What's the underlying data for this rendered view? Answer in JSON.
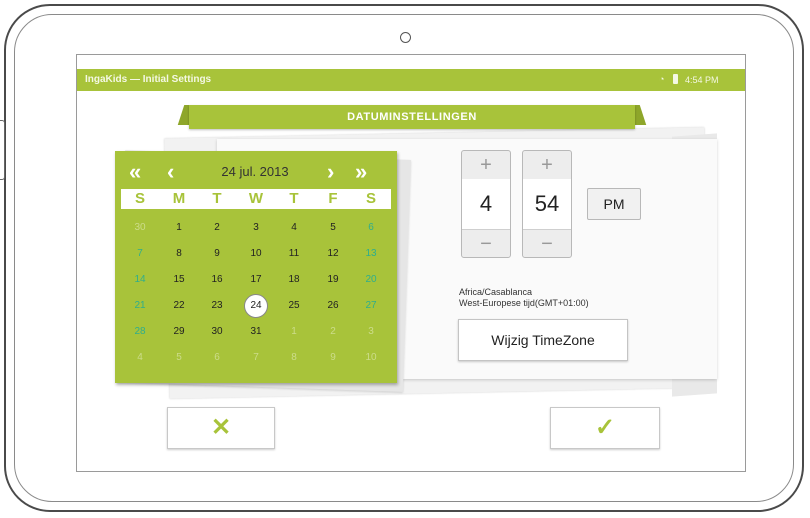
{
  "titlebar": {
    "app_title": "IngaKids — Initial Settings",
    "time": "4:54 PM",
    "wifi_icon": "wifi-icon",
    "battery_icon": "battery-icon"
  },
  "banner": {
    "title": "DATUMINSTELLINGEN"
  },
  "calendar": {
    "nav_prev_year": "«",
    "nav_prev_month": "‹",
    "nav_next_month": "›",
    "nav_next_year": "»",
    "month_label": "24 jul. 2013",
    "weekdays": [
      "S",
      "M",
      "T",
      "W",
      "T",
      "F",
      "S"
    ],
    "weeks": [
      [
        "30",
        "1",
        "2",
        "3",
        "4",
        "5",
        "6"
      ],
      [
        "7",
        "8",
        "9",
        "10",
        "11",
        "12",
        "13"
      ],
      [
        "14",
        "15",
        "16",
        "17",
        "18",
        "19",
        "20"
      ],
      [
        "21",
        "22",
        "23",
        "24",
        "25",
        "26",
        "27"
      ],
      [
        "28",
        "29",
        "30",
        "31",
        "1",
        "2",
        "3"
      ],
      [
        "4",
        "5",
        "6",
        "7",
        "8",
        "9",
        "10"
      ]
    ],
    "selected": "24"
  },
  "time": {
    "plus": "+",
    "minus": "−",
    "hour": "4",
    "minute": "54",
    "ampm": "PM"
  },
  "timezone": {
    "region": "Africa/Casablanca",
    "description": "West-Europese tijd(GMT+01:00)",
    "change_label": "Wijzig TimeZone"
  },
  "actions": {
    "cancel_glyph": "✕",
    "confirm_glyph": "✓"
  },
  "colors": {
    "accent": "#a8c33a",
    "weekend": "#2fae8c",
    "cancel": "#a8c33a",
    "confirm": "#a8c33a"
  }
}
